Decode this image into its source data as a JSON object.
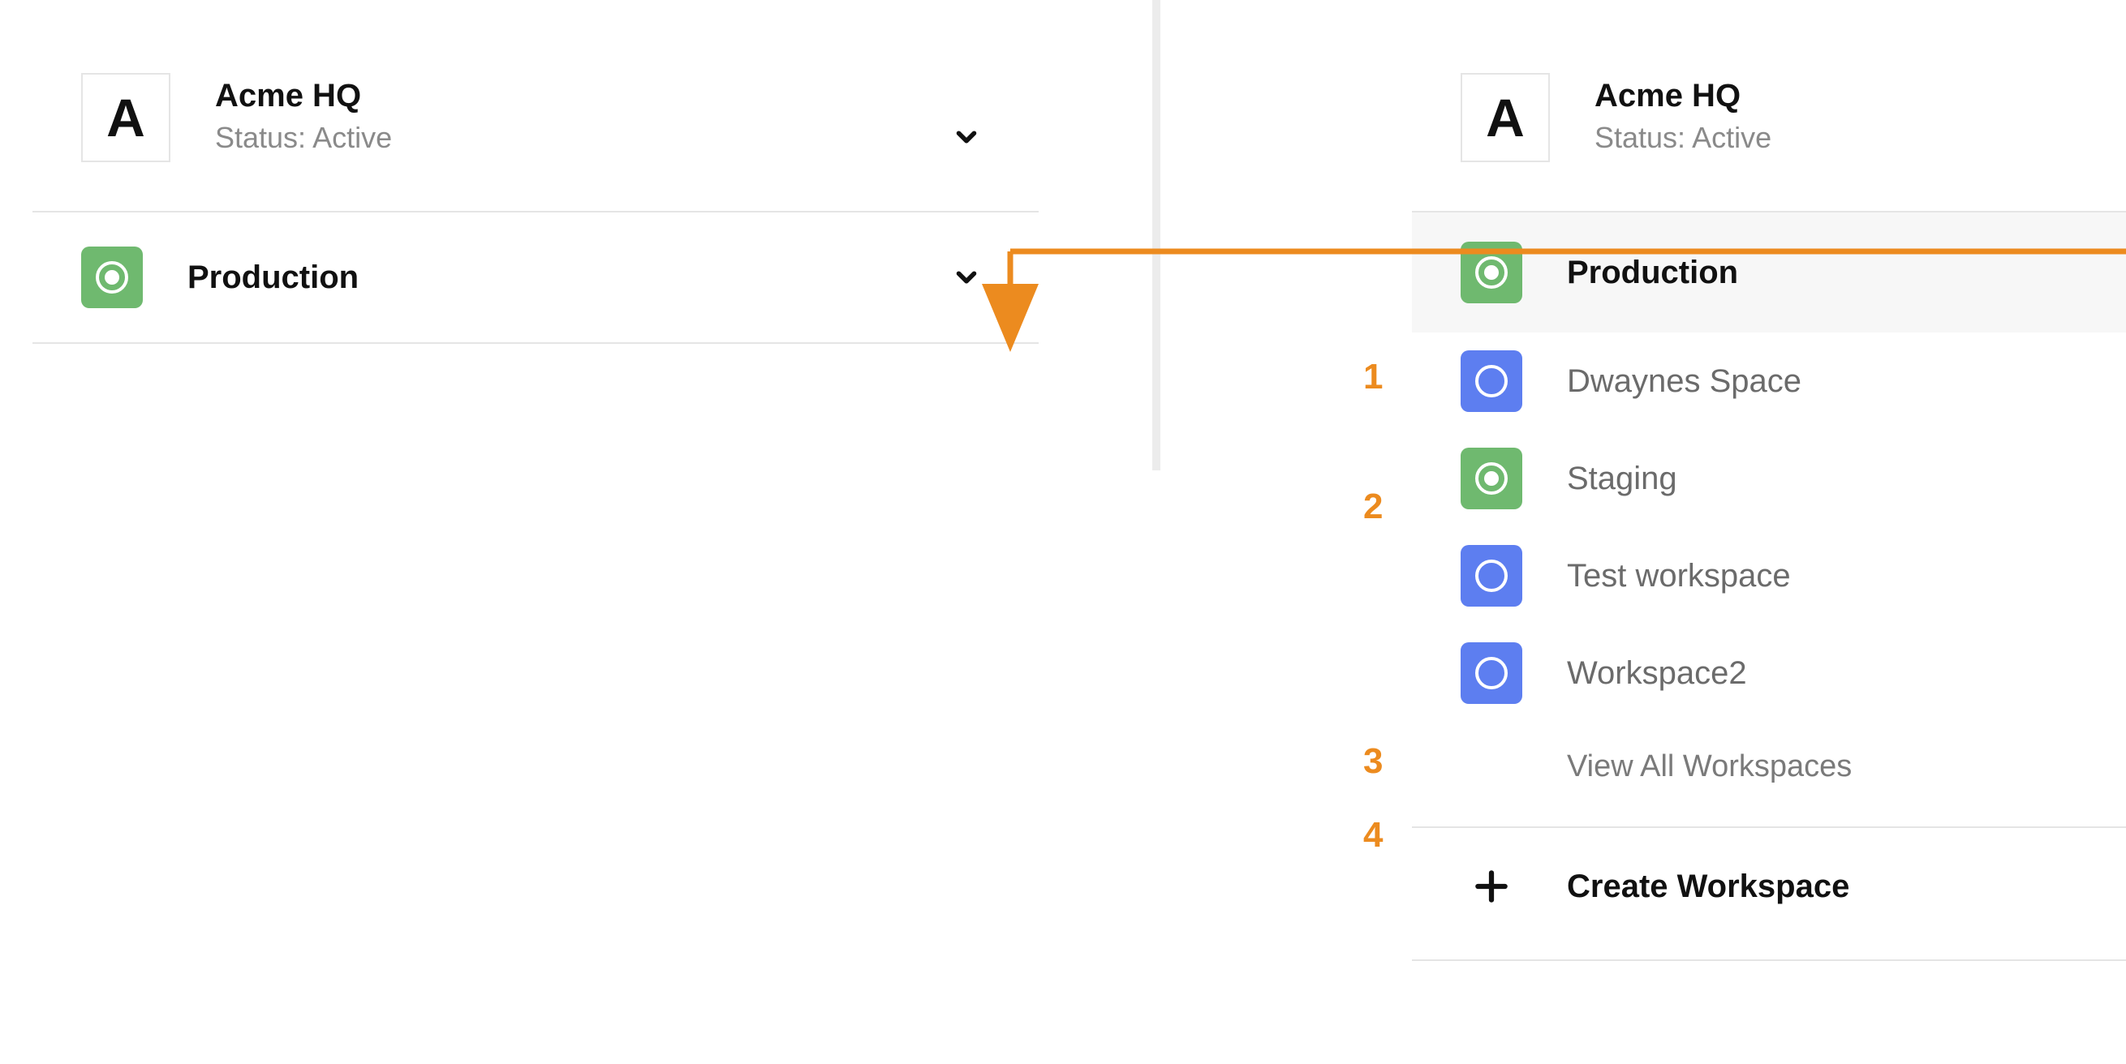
{
  "colors": {
    "accent_orange": "#ec8b1f",
    "icon_green": "#6fb96f",
    "icon_blue": "#5d7ef0"
  },
  "org": {
    "avatar_letter": "A",
    "name": "Acme HQ",
    "status": "Status: Active"
  },
  "left_panel": {
    "selected_workspace": "Production"
  },
  "right_panel": {
    "selected_workspace": "Production",
    "workspaces": [
      {
        "label": "Dwaynes Space",
        "icon": "moon",
        "color": "blue"
      },
      {
        "label": "Staging",
        "icon": "circle",
        "color": "green"
      },
      {
        "label": "Test workspace",
        "icon": "moon",
        "color": "blue"
      },
      {
        "label": "Workspace2",
        "icon": "moon",
        "color": "blue"
      }
    ],
    "view_all_label": "View All Workspaces",
    "create_label": "Create Workspace"
  },
  "callouts": {
    "n1": "1",
    "n2": "2",
    "n3": "3",
    "n4": "4"
  }
}
